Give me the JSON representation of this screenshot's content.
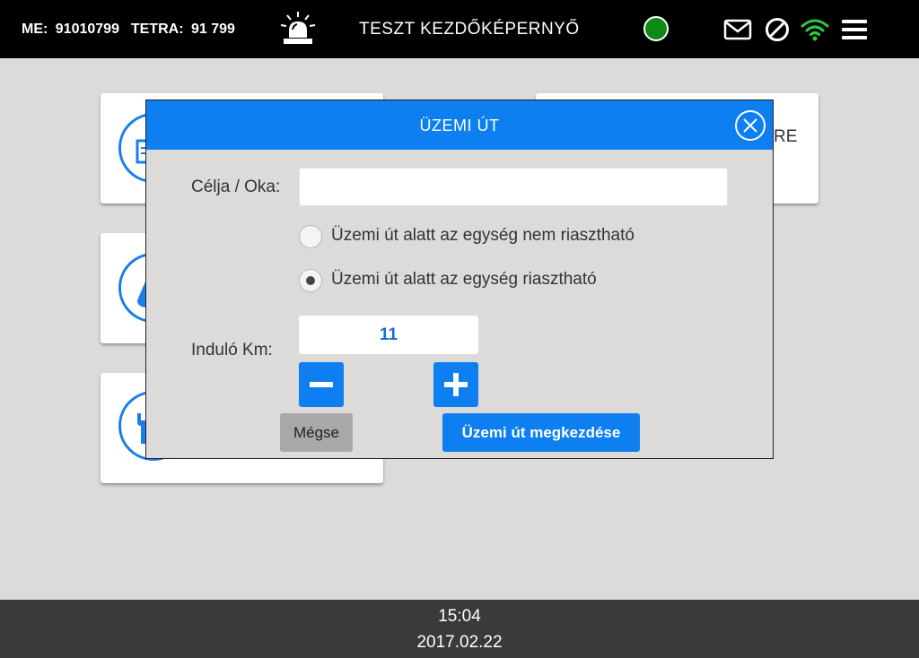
{
  "header": {
    "me_label": "ME:",
    "me_value": "91010799",
    "tetra_label": "TETRA:",
    "tetra_value": "91 799",
    "title": "TESZT KEZDŐKÉPERNYŐ",
    "status_color": "#0b8a16",
    "icons": [
      "siren-icon",
      "mail-icon",
      "block-icon",
      "wifi-icon",
      "menu-icon"
    ]
  },
  "background_tiles": [
    {
      "label": "",
      "icon": "document-icon"
    },
    {
      "label": "RE",
      "icon": ""
    },
    {
      "label": "",
      "icon": "drop-icon"
    },
    {
      "label": "",
      "icon": "wrench-icon"
    }
  ],
  "dialog": {
    "title": "ÜZEMI ÚT",
    "purpose_label": "Célja / Oka:",
    "purpose_value": "",
    "radio_options": [
      {
        "label": "Üzemi út alatt az egység nem riasztható",
        "selected": false
      },
      {
        "label": "Üzemi út alatt az egység riasztható",
        "selected": true
      }
    ],
    "km_label": "Induló Km:",
    "km_value": "11",
    "cancel_label": "Mégse",
    "start_label": "Üzemi út megkezdése"
  },
  "footer": {
    "time": "15:04",
    "date": "2017.02.22"
  },
  "colors": {
    "accent": "#0e7ff0",
    "background": "#dcdbd9",
    "status_online": "#0b8a16",
    "wifi": "#2ecc40"
  }
}
